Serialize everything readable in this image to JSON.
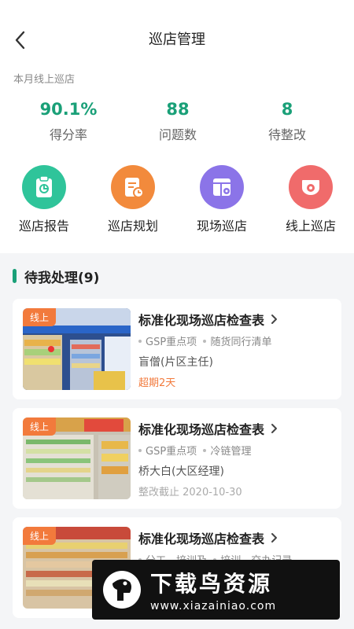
{
  "header": {
    "title": "巡店管理"
  },
  "summary": {
    "subtitle": "本月线上巡店"
  },
  "stats": [
    {
      "value": "90.1%",
      "label": "得分率"
    },
    {
      "value": "88",
      "label": "问题数"
    },
    {
      "value": "8",
      "label": "待整改"
    }
  ],
  "menu": [
    {
      "label": "巡店报告",
      "icon": "report-icon",
      "color": "#2fc49a"
    },
    {
      "label": "巡店规划",
      "icon": "plan-icon",
      "color": "#f28a3c"
    },
    {
      "label": "现场巡店",
      "icon": "onsite-icon",
      "color": "#8b74e8"
    },
    {
      "label": "线上巡店",
      "icon": "camera-icon",
      "color": "#f06b6b"
    }
  ],
  "pending": {
    "title": "待我处理(9)"
  },
  "cards": [
    {
      "tag": "线上",
      "title": "标准化现场巡店检查表",
      "tags": [
        "GSP重点项",
        "随货同行清单"
      ],
      "person": "盲僧(片区主任)",
      "status": "超期2天"
    },
    {
      "tag": "线上",
      "title": "标准化现场巡店检查表",
      "tags": [
        "GSP重点项",
        "冷链管理"
      ],
      "person": "桥大白(大区经理)",
      "status": "整改截止 2020-10-30"
    },
    {
      "tag": "线上",
      "title": "标准化现场巡店检查表",
      "tags": [
        "分工、培训及",
        "培训、交办记录"
      ],
      "person": "",
      "status": ""
    }
  ],
  "watermark": {
    "cn": "下载鸟资源",
    "en": "www.xiazainiao.com"
  }
}
